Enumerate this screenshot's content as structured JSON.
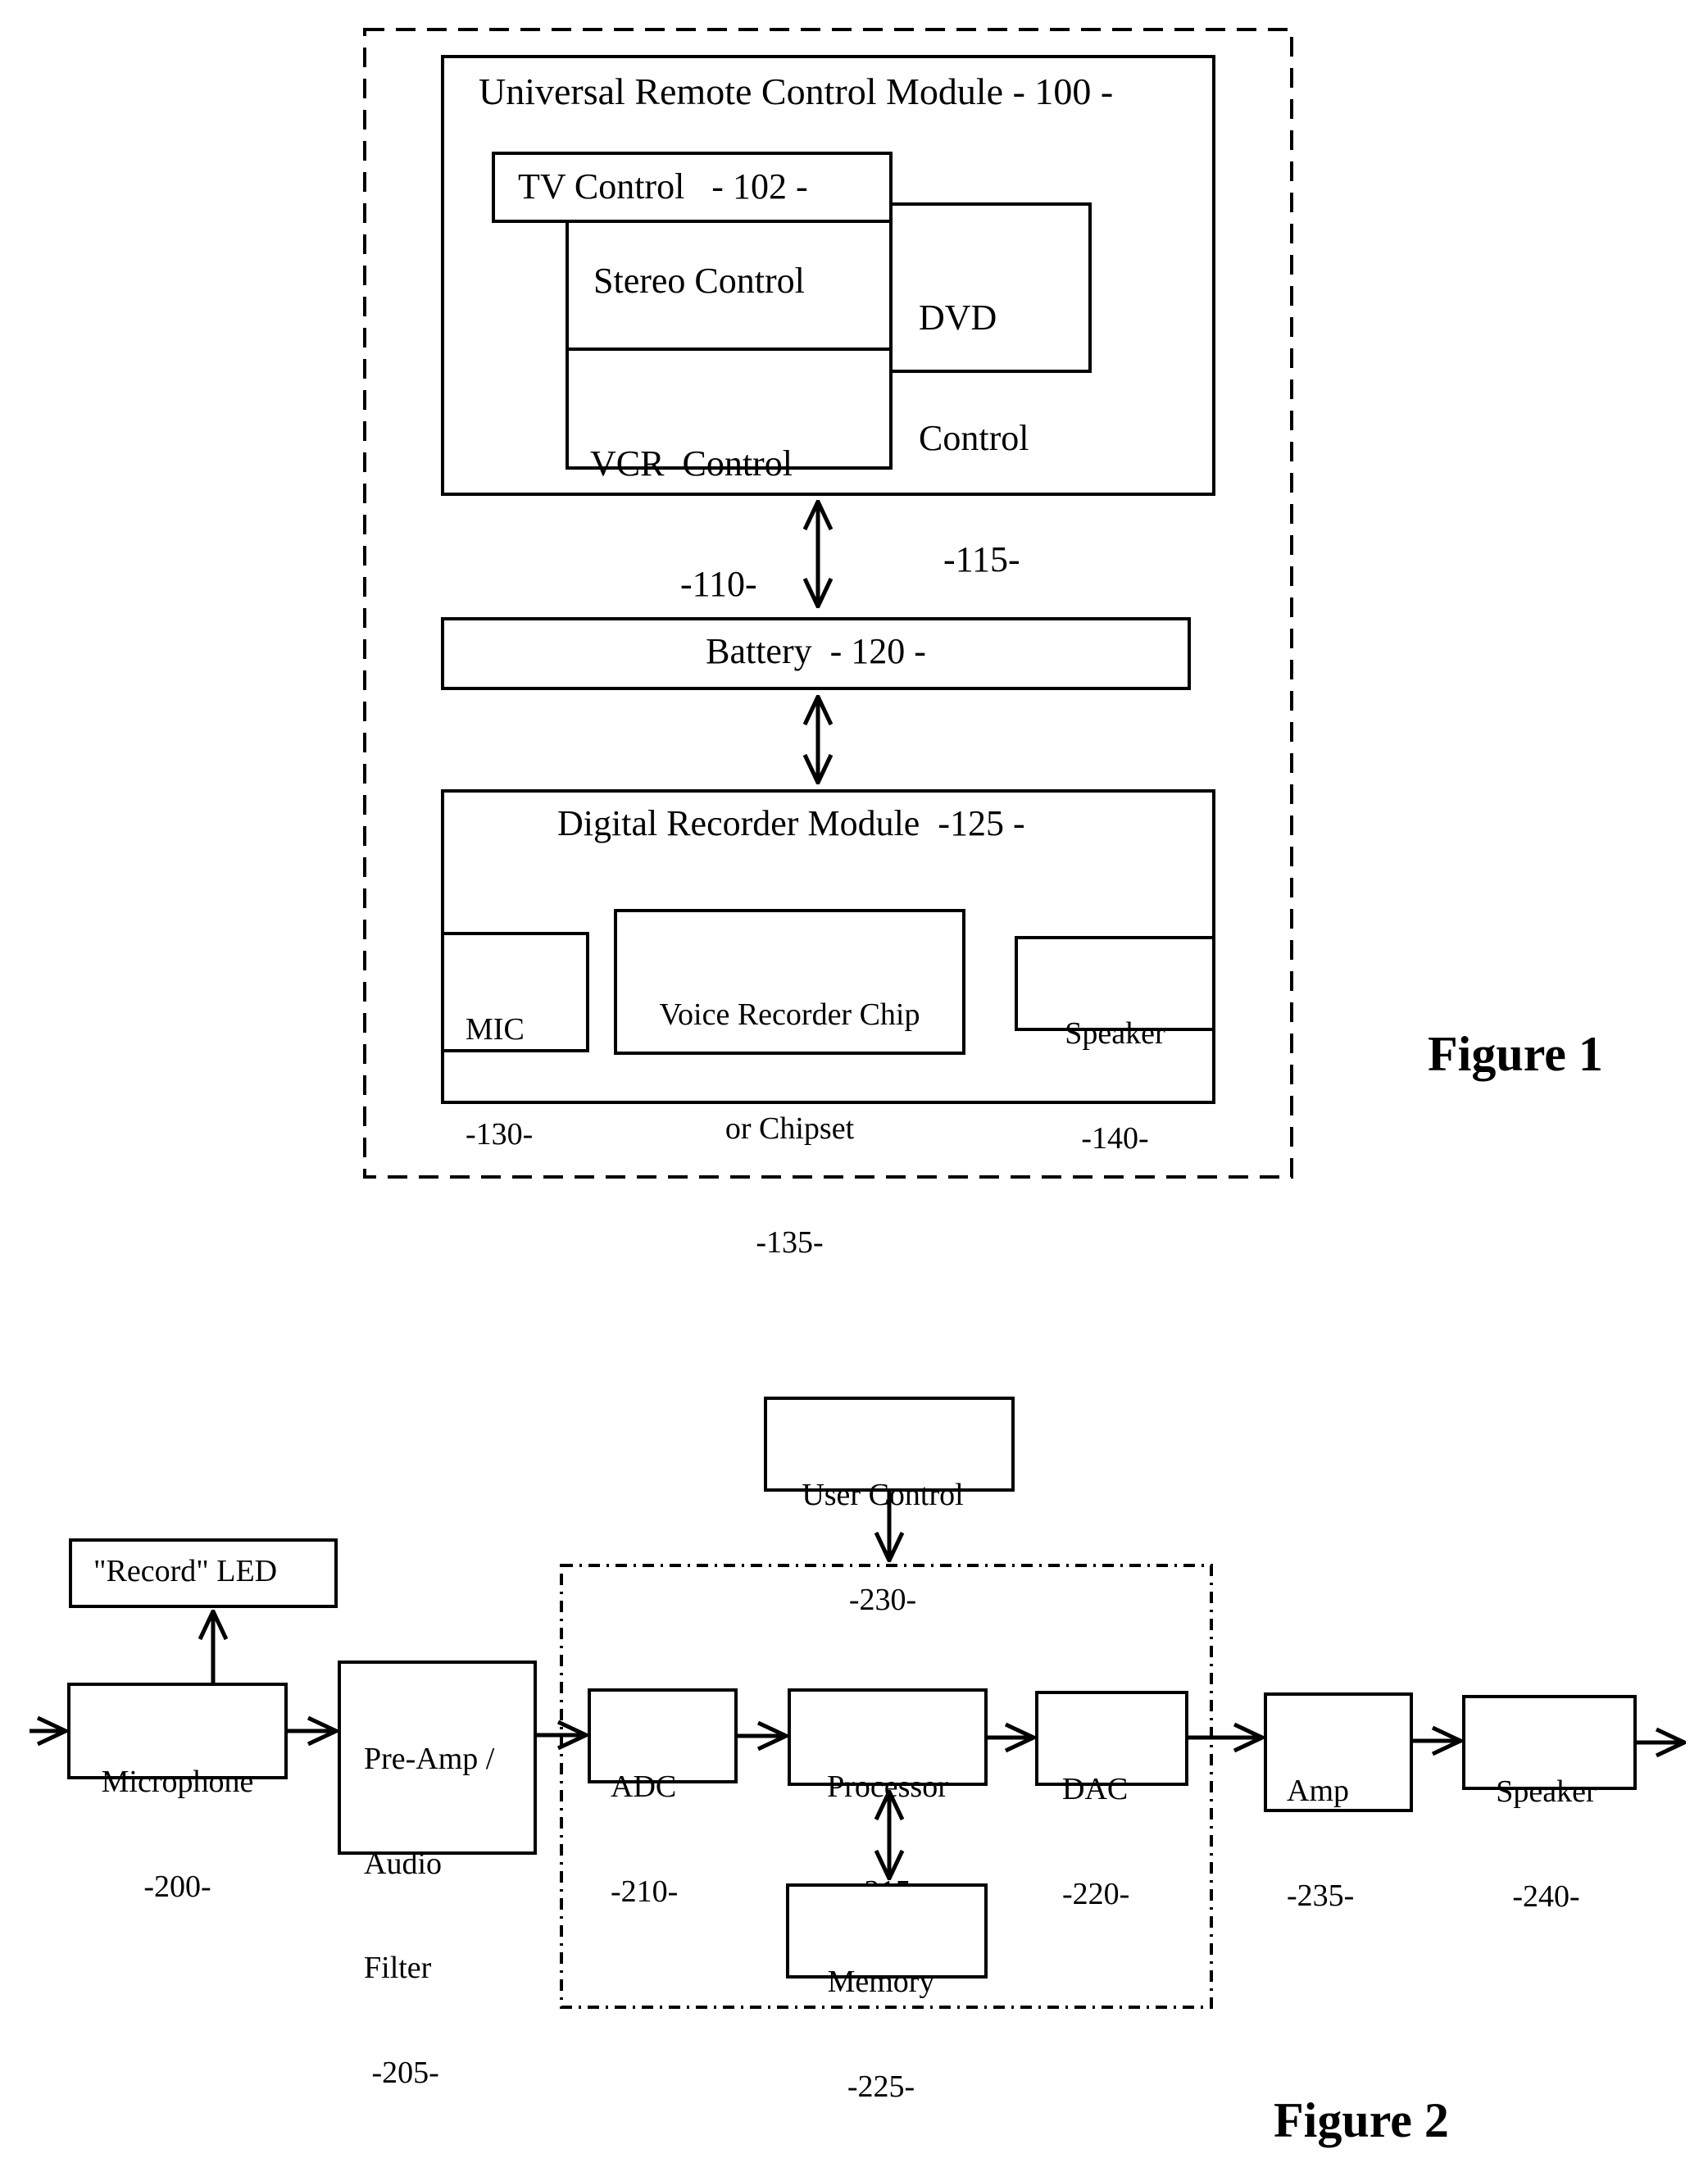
{
  "figure1": {
    "caption": "Figure 1",
    "urc_module": {
      "title": "Universal Remote Control Module - 100 -"
    },
    "tv_control": {
      "label": "TV Control   - 102 -"
    },
    "stereo_control": {
      "label": "Stereo Control"
    },
    "vcr_control": {
      "line1": "VCR  Control",
      "line2": "-110-"
    },
    "dvd_control": {
      "line1": "DVD",
      "line2": "Control",
      "line3": "-115-"
    },
    "battery": {
      "label": "Battery  - 120 -"
    },
    "digital_recorder": {
      "title": "Digital Recorder Module  -125 -"
    },
    "mic": {
      "line1": "MIC",
      "line2": "-130-"
    },
    "voice_chip": {
      "line1": "Voice Recorder Chip",
      "line2": "or Chipset",
      "line3": "-135-"
    },
    "speaker": {
      "line1": "Speaker",
      "line2": "-140-"
    }
  },
  "figure2": {
    "caption": "Figure 2",
    "user_control": {
      "line1": "User Control",
      "line2": "-230-"
    },
    "record_led": {
      "label": "\"Record\" LED"
    },
    "microphone": {
      "line1": "Microphone",
      "line2": "-200-"
    },
    "preamp": {
      "line1": "Pre-Amp /",
      "line2": "Audio",
      "line3": "Filter",
      "line4": " -205-"
    },
    "adc": {
      "line1": "ADC",
      "line2": "-210-"
    },
    "processor": {
      "line1": "Processor",
      "line2": "-215-"
    },
    "dac": {
      "line1": "DAC",
      "line2": "-220-"
    },
    "memory": {
      "line1": "Memory",
      "line2": "-225-"
    },
    "amp": {
      "line1": "Amp",
      "line2": "-235-"
    },
    "speaker": {
      "line1": "Speaker",
      "line2": "-240-"
    }
  }
}
